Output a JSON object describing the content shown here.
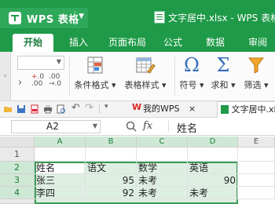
{
  "app": {
    "name": "WPS 表格",
    "window_title": "文字居中.xlsx - WPS 表格"
  },
  "tabs": [
    {
      "label": "开始",
      "active": true
    },
    {
      "label": "插入"
    },
    {
      "label": "页面布局"
    },
    {
      "label": "公式"
    },
    {
      "label": "数据"
    },
    {
      "label": "审阅"
    }
  ],
  "ribbon": {
    "format_left_symbol": "›",
    "increase_decimal": "+.0\n.00",
    "decrease_decimal": ".00\n→.0",
    "conditional_format": "条件格式",
    "table_style": "表格样式",
    "symbol": "符号",
    "sum": "求和",
    "filter": "筛选"
  },
  "quick_access": {
    "doc_tabs": [
      {
        "label": "我的WPS",
        "close": "×"
      },
      {
        "label": "文字居中.xl",
        "active": true
      }
    ]
  },
  "formula_bar": {
    "cell_ref": "A2",
    "fx": "fx",
    "formula": "姓名"
  },
  "grid": {
    "columns": [
      "A",
      "B",
      "C",
      "D",
      "E"
    ],
    "rows": [
      {
        "num": "1",
        "cells": [
          "",
          "",
          "",
          "",
          ""
        ]
      },
      {
        "num": "2",
        "cells": [
          "姓名",
          "语文",
          "数学",
          "英语",
          ""
        ]
      },
      {
        "num": "3",
        "cells": [
          "张三",
          "95",
          "未考",
          "90",
          ""
        ]
      },
      {
        "num": "4",
        "cells": [
          "李四",
          "92",
          "未考",
          "未考",
          ""
        ]
      }
    ]
  },
  "colors": {
    "brand": "#1e9a48",
    "selection": "#cfe8d6"
  }
}
